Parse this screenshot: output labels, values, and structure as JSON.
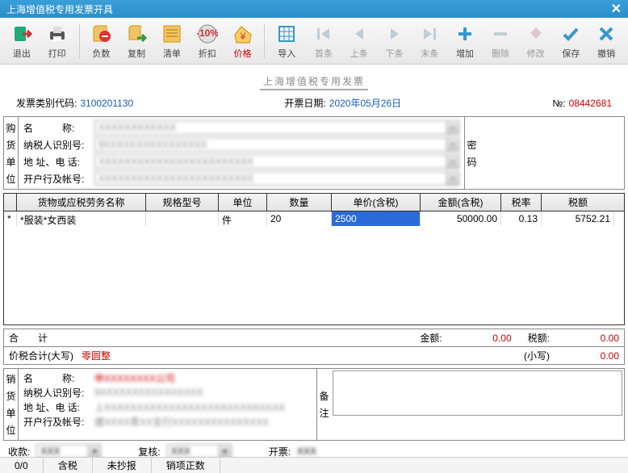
{
  "window_title": "上海增值税专用发票开具",
  "toolbar": {
    "exit": "退出",
    "print": "打印",
    "negative": "负数",
    "copy": "复制",
    "list": "清单",
    "discount": "折扣",
    "price": "价格",
    "import": "导入",
    "first": "首条",
    "prev": "上条",
    "next": "下条",
    "last": "末条",
    "add": "增加",
    "delete": "删除",
    "modify": "修改",
    "save": "保存",
    "cancel": "撤销"
  },
  "invoice_title": "上海增值税专用发票",
  "code_label": "发票类别代码:",
  "code_val": "3100201130",
  "date_label": "开票日期:",
  "date_val": "2020年05月26日",
  "no_label": "№:",
  "no_val": "08442681",
  "buyer_side": "购货单位",
  "seller_side": "销货单位",
  "pwd_side": "密码",
  "remark_side": "备注",
  "labels": {
    "name": "名　　　称:",
    "taxid": "纳税人识别号:",
    "addr": "地 址、电 话:",
    "bank": "开户行及帐号:"
  },
  "buyer": {
    "name": "XXXXXXXXXXXX",
    "taxid": "9XXXXXXXXXXXXXXXX",
    "addr": "XXXXXXXXXXXXXXXXXXXXXXXX",
    "bank": "XXXXXXXXXXXXXXXXXXXXXXXX"
  },
  "seller": {
    "name": "申XXXXXXXX公司",
    "taxid": "9XXXXXXXXXXXXXXXX",
    "addr": "上XXXXXXXXXXXXXXXXXXXXXXXXXXXX",
    "bank": "建XXXX青XX支行XXXXXXXXXXXXXXX"
  },
  "cols": {
    "h0": "",
    "h1": "货物或应税劳务名称",
    "h2": "规格型号",
    "h3": "单位",
    "h4": "数量",
    "h5": "单价(含税)",
    "h6": "金额(含税)",
    "h7": "税率",
    "h8": "税额"
  },
  "row": {
    "star": "*",
    "name": "*服装*女西装",
    "spec": "",
    "unit": "件",
    "qty": "20",
    "price": "2500",
    "amount": "50000.00",
    "rate": "0.13",
    "tax": "5752.21"
  },
  "totals": {
    "sum_lbl": "合　　计",
    "amt_lbl": "金额:",
    "amt_val": "0.00",
    "tax_lbl": "税额:",
    "tax_val": "0.00",
    "upper_lbl": "价税合计(大写)",
    "upper_val": "零圆整",
    "lower_lbl": "(小写)",
    "lower_val": "0.00"
  },
  "sig": {
    "sk": "收款:",
    "sk_v": "XXX",
    "fh": "复核:",
    "fh_v": "XXX",
    "kp": "开票:",
    "kp_v": "XXX"
  },
  "status": {
    "pos": "0/0",
    "tax_mode": "含税",
    "copy_stat": "未抄报",
    "pos_stat": "销项正数"
  }
}
